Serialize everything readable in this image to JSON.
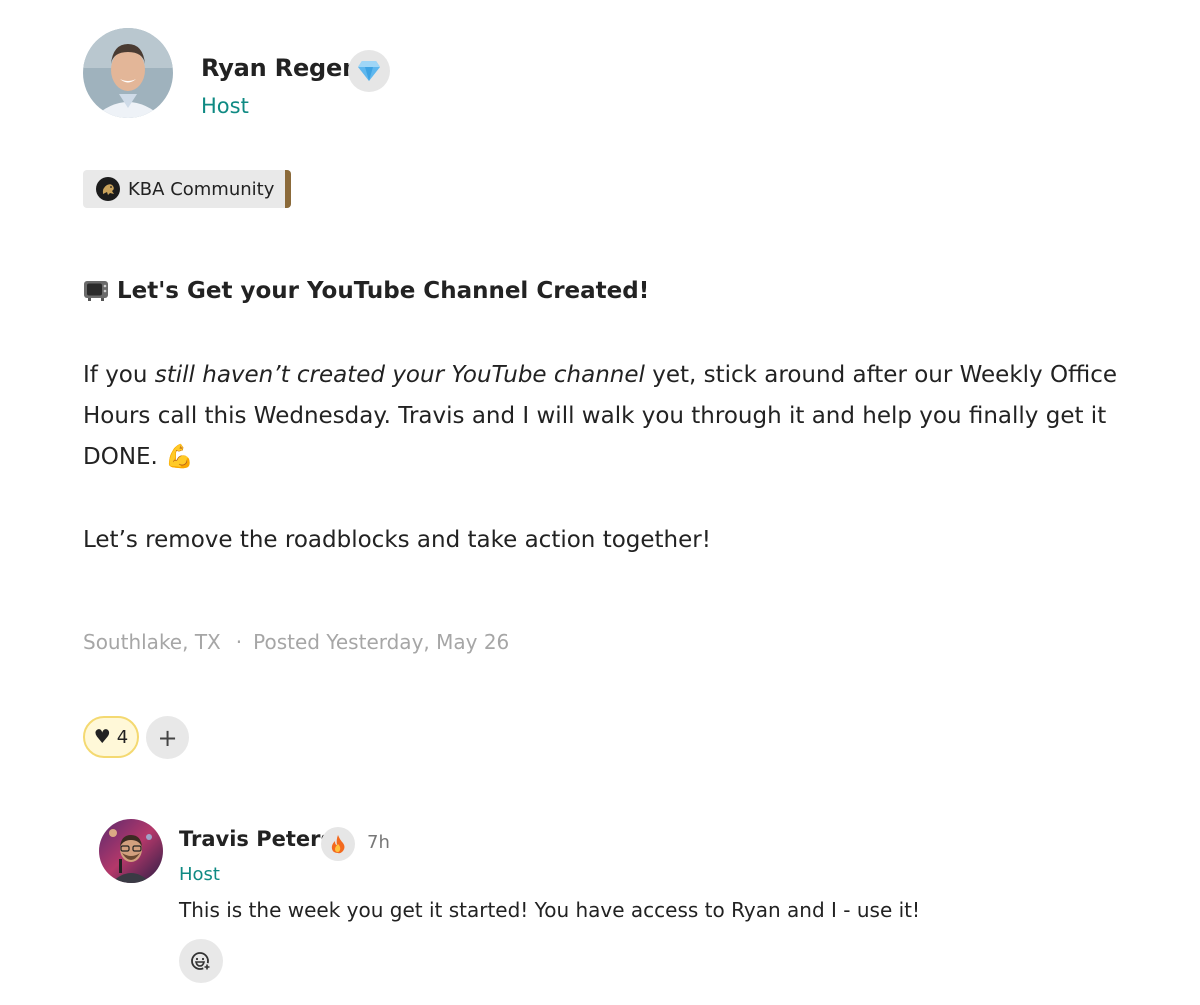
{
  "author": {
    "name": "Ryan Reger",
    "role": "Host",
    "badge_icon": "diamond-icon"
  },
  "community": {
    "label": "KBA Community",
    "accent_color": "#8b6a3a"
  },
  "post": {
    "title": "Let's Get your YouTube Channel Created!",
    "title_icon": "television-icon",
    "body_line1_pre": "If you ",
    "body_line1_em": "still haven’t created your YouTube channel",
    "body_line1_post": " yet, stick around after our Weekly Office Hours call this Wednesday. Travis and I will walk you through it and help you finally get it DONE.",
    "body_emoji": "💪",
    "body_line2": "Let’s remove the roadblocks and take action together!",
    "location": "Southlake, TX",
    "separator": "·",
    "posted": "Posted Yesterday, May 26"
  },
  "reactions": {
    "heart_count": "4",
    "add_label": "+"
  },
  "comment": {
    "author": "Travis Peters",
    "badge_icon": "fire-icon",
    "time": "7h",
    "role": "Host",
    "text": "This is the week you get it started! You have access to Ryan and I - use it!"
  },
  "colors": {
    "role_teal": "#0f8a83",
    "meta_gray": "#a6a6a6",
    "reaction_border": "#f4d971",
    "reaction_bg": "#fff8d8"
  }
}
